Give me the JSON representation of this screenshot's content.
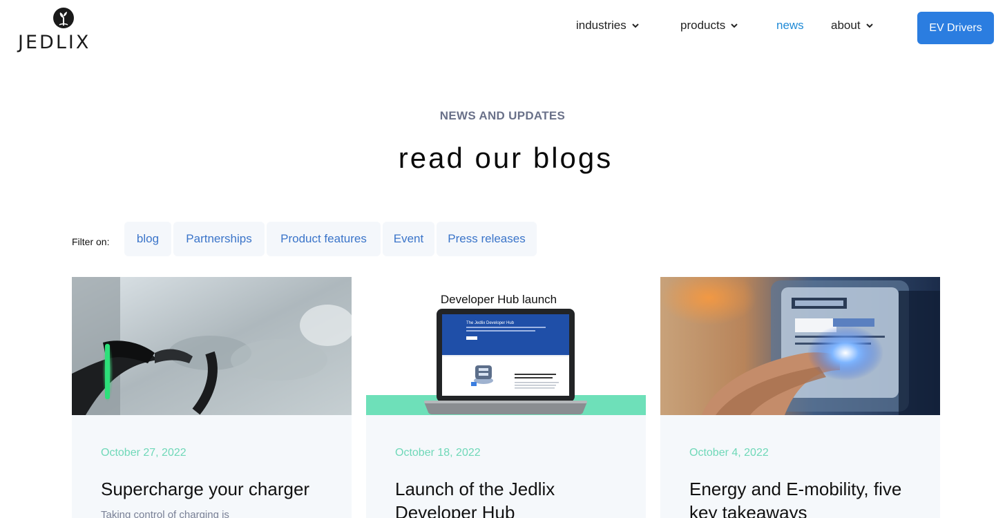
{
  "logo": {
    "text": "JEDLIX"
  },
  "nav": {
    "items": [
      {
        "label": "industries",
        "dropdown": true,
        "active": false
      },
      {
        "label": "products",
        "dropdown": true,
        "active": false
      },
      {
        "label": "news",
        "dropdown": false,
        "active": true
      },
      {
        "label": "about",
        "dropdown": true,
        "active": false
      }
    ],
    "cta_label": "EV Drivers"
  },
  "hero": {
    "eyebrow": "NEWS AND UPDATES",
    "title": "read our blogs"
  },
  "filters": {
    "label": "Filter on:",
    "chips": [
      "blog",
      "Partnerships",
      "Product features",
      "Event",
      "Press releases"
    ]
  },
  "cards": [
    {
      "image": "ev-charger-plug-photo",
      "date": "October 27, 2022",
      "title": "Supercharge your charger",
      "excerpt": "Taking control of charging is"
    },
    {
      "image": "developer-hub-laptop-illustration",
      "image_caption": "Developer Hub launch",
      "screen_heading": "The Jedlix Developer Hub",
      "date": "October 18, 2022",
      "title": "Launch of the Jedlix Developer Hub",
      "excerpt": ""
    },
    {
      "image": "electricity-meter-photo",
      "date": "October 4, 2022",
      "title": "Energy and E-mobility, five key takeaways",
      "excerpt": ""
    }
  ],
  "colors": {
    "accent_blue": "#2b7de0",
    "nav_active": "#1f8ad6",
    "chip_text": "#3a74c9",
    "date_green": "#6fd8b8",
    "eyebrow_gray": "#6a7189",
    "card_bg": "#f5f8fb"
  }
}
